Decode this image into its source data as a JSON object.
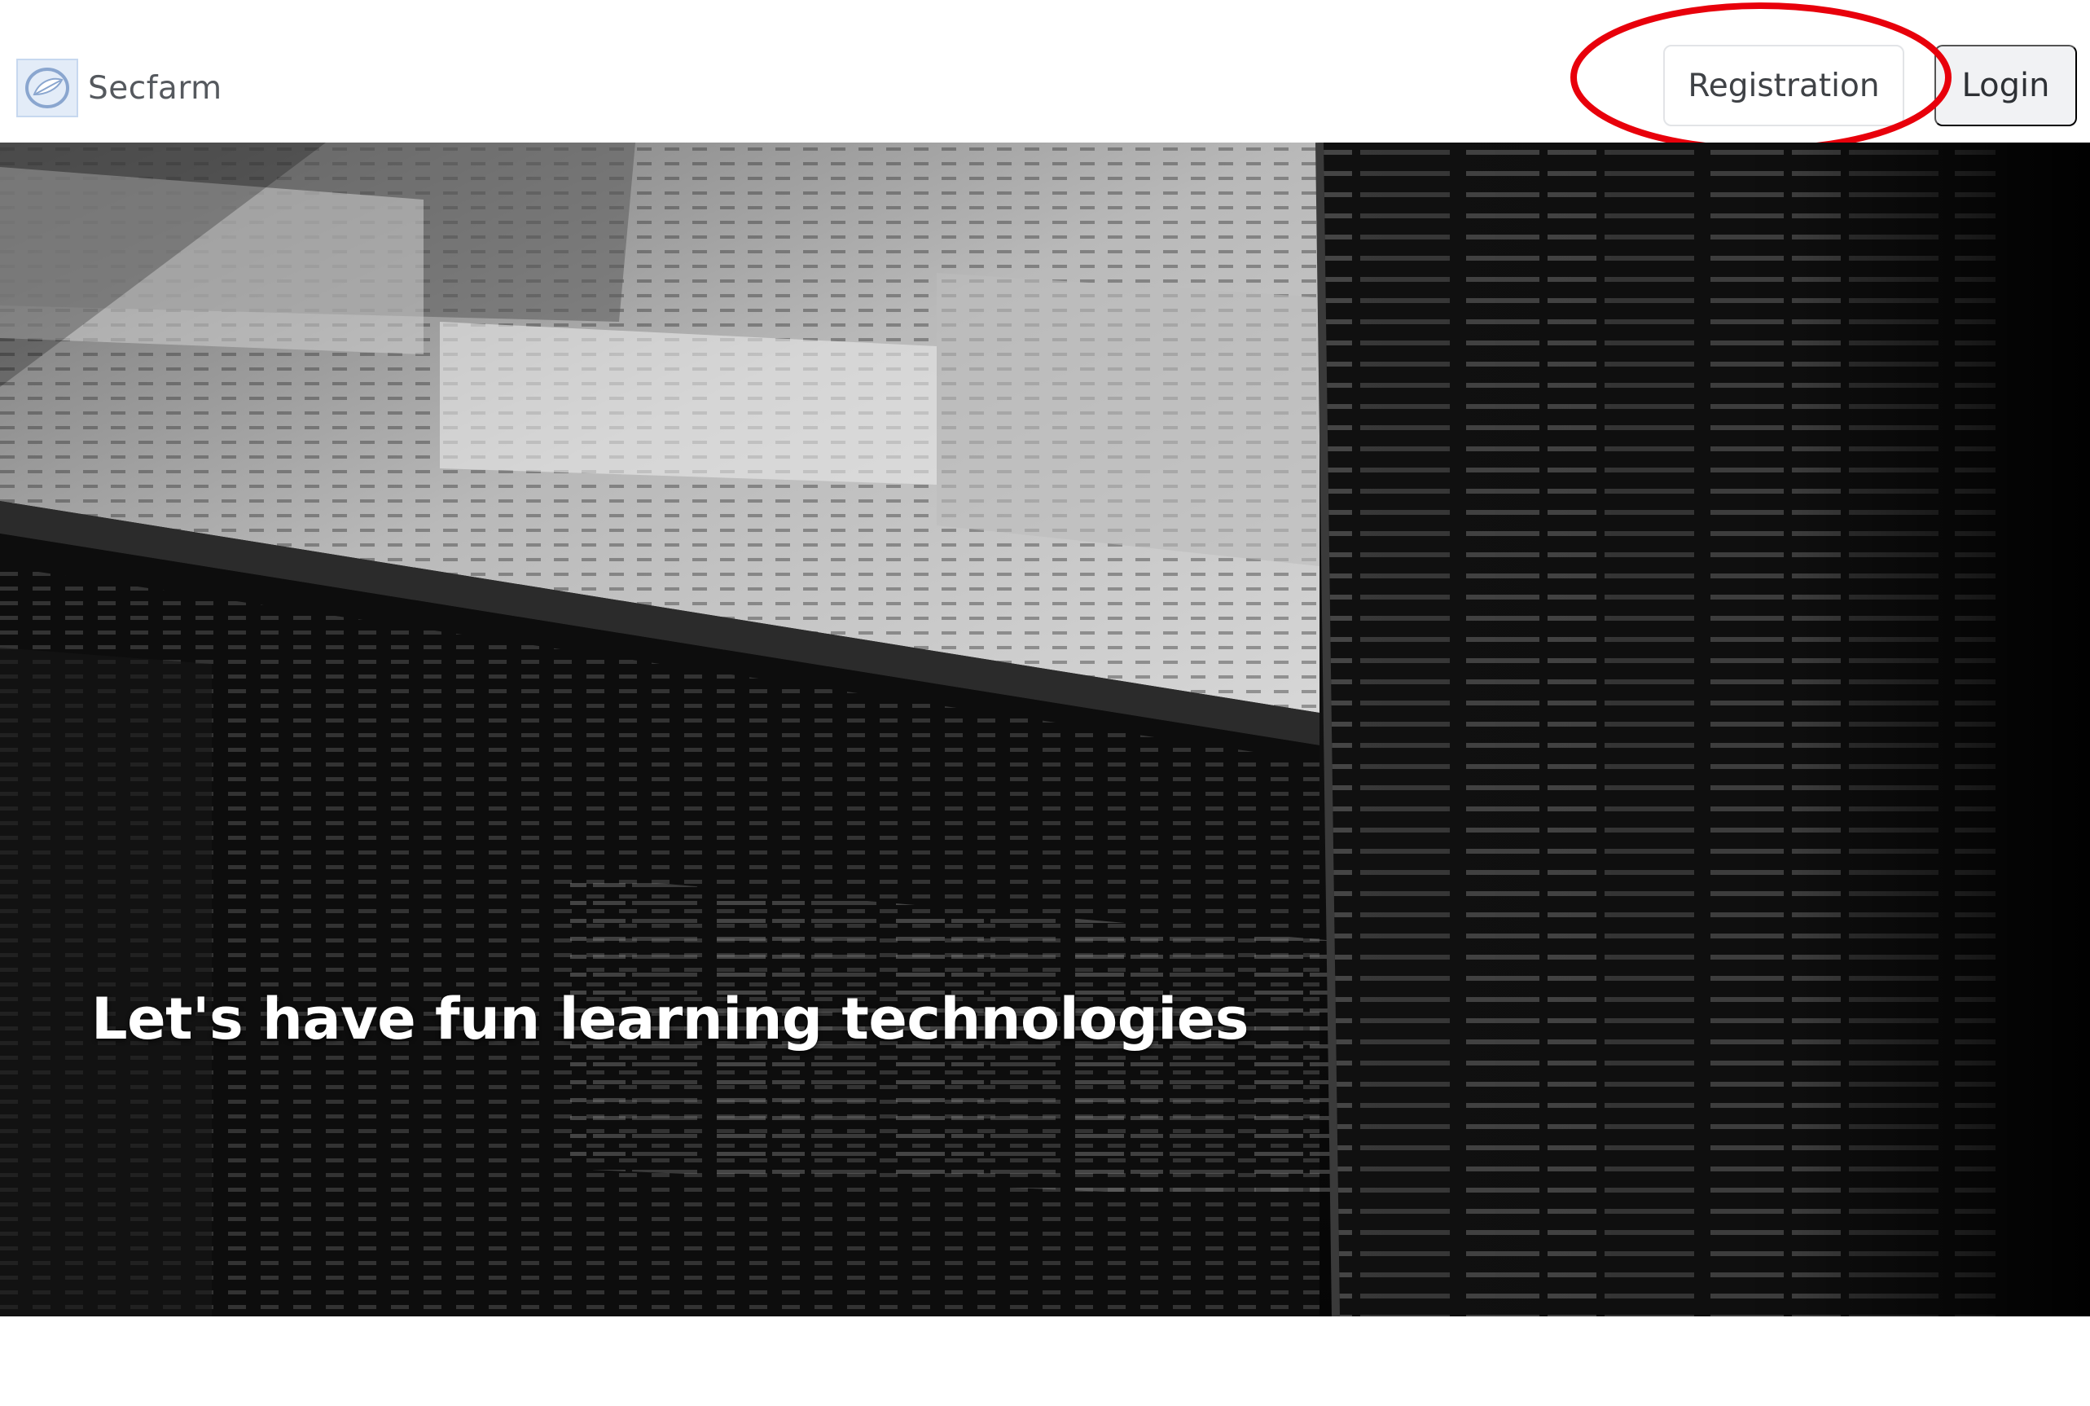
{
  "header": {
    "brand_name": "Secfarm",
    "logo_icon": "leaf-logo-icon",
    "registration_label": "Registration",
    "login_label": "Login",
    "annotation_color": "#e8000b"
  },
  "hero": {
    "title": "Let's have fun learning technologies",
    "background": "monochrome-terminal-screens-photo"
  }
}
